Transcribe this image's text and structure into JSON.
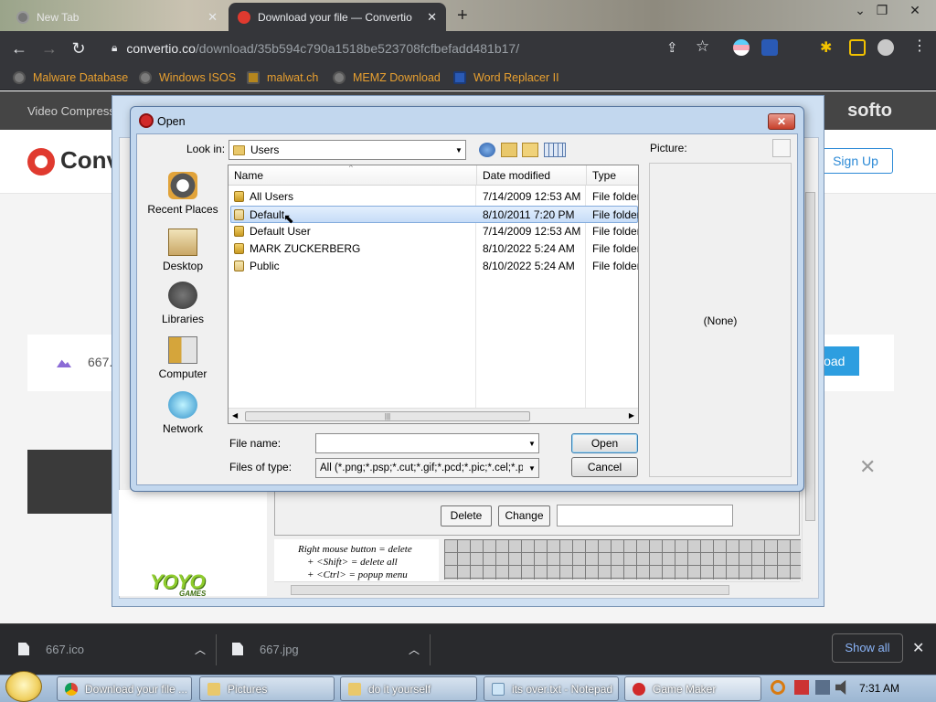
{
  "browser": {
    "tabs": [
      {
        "title": "New Tab",
        "active": false
      },
      {
        "title": "Download your file — Convertio",
        "active": true
      }
    ],
    "new_tab_symbol": "+",
    "url_host": "convertio.co",
    "url_path": "/download/35b594c790a1518be523708fcfbefadd481b17/",
    "bookmarks": [
      "Malware Database",
      "Windows ISOS",
      "malwat.ch",
      "MEMZ Download",
      "Word Replacer II"
    ],
    "window_controls": [
      "–",
      "❐",
      "✕"
    ]
  },
  "page": {
    "topbar_text": "Video Compress",
    "topbar_brand": "softo",
    "logo_text": "Conv",
    "signup_label": "Sign Up",
    "file_name": "667.",
    "download_label": "load"
  },
  "gamemaker": {
    "delete_label": "Delete",
    "change_label": "Change",
    "help_lines": [
      "Right mouse button = delete",
      "+ <Shift> = delete all",
      "+ <Ctrl> = popup menu"
    ],
    "logo_top": "YOYO",
    "logo_bottom": "GAMES"
  },
  "dialog": {
    "title": "Open",
    "close_symbol": "✕",
    "look_in_label": "Look in:",
    "look_in_value": "Users",
    "places": [
      "Recent Places",
      "Desktop",
      "Libraries",
      "Computer",
      "Network"
    ],
    "columns": [
      "Name",
      "Date modified",
      "Type"
    ],
    "rows": [
      {
        "name": "All Users",
        "date": "7/14/2009 12:53 AM",
        "type": "File folder",
        "selected": false
      },
      {
        "name": "Default",
        "date": "8/10/2011 7:20 PM",
        "type": "File folder",
        "selected": true
      },
      {
        "name": "Default User",
        "date": "7/14/2009 12:53 AM",
        "type": "File folder",
        "selected": false
      },
      {
        "name": "MARK ZUCKERBERG",
        "date": "8/10/2022 5:24 AM",
        "type": "File folder",
        "selected": false
      },
      {
        "name": "Public",
        "date": "8/10/2022 5:24 AM",
        "type": "File folder",
        "selected": false
      }
    ],
    "file_name_label": "File name:",
    "file_name_value": "",
    "files_of_type_label": "Files of type:",
    "files_of_type_value": "All (*.png;*.psp;*.cut;*.gif;*.pcd;*.pic;*.cel;*.pbm",
    "open_label": "Open",
    "cancel_label": "Cancel",
    "picture_label": "Picture:",
    "picture_none": "(None)"
  },
  "downloads": {
    "items": [
      "667.ico",
      "667.jpg"
    ],
    "show_all_label": "Show all",
    "close_symbol": "✕"
  },
  "taskbar": {
    "buttons": [
      "Download your file ...",
      "Pictures",
      "do it yourself",
      "its over.txt - Notepad",
      "Game Maker"
    ],
    "clock": "7:31 AM"
  },
  "colors": {
    "chrome_dark": "#35363a",
    "bookmark_text": "#e8a030",
    "convertio_red": "#e03a2f",
    "selection": "#c6dcf7",
    "show_all_text": "#8ab4f8"
  }
}
